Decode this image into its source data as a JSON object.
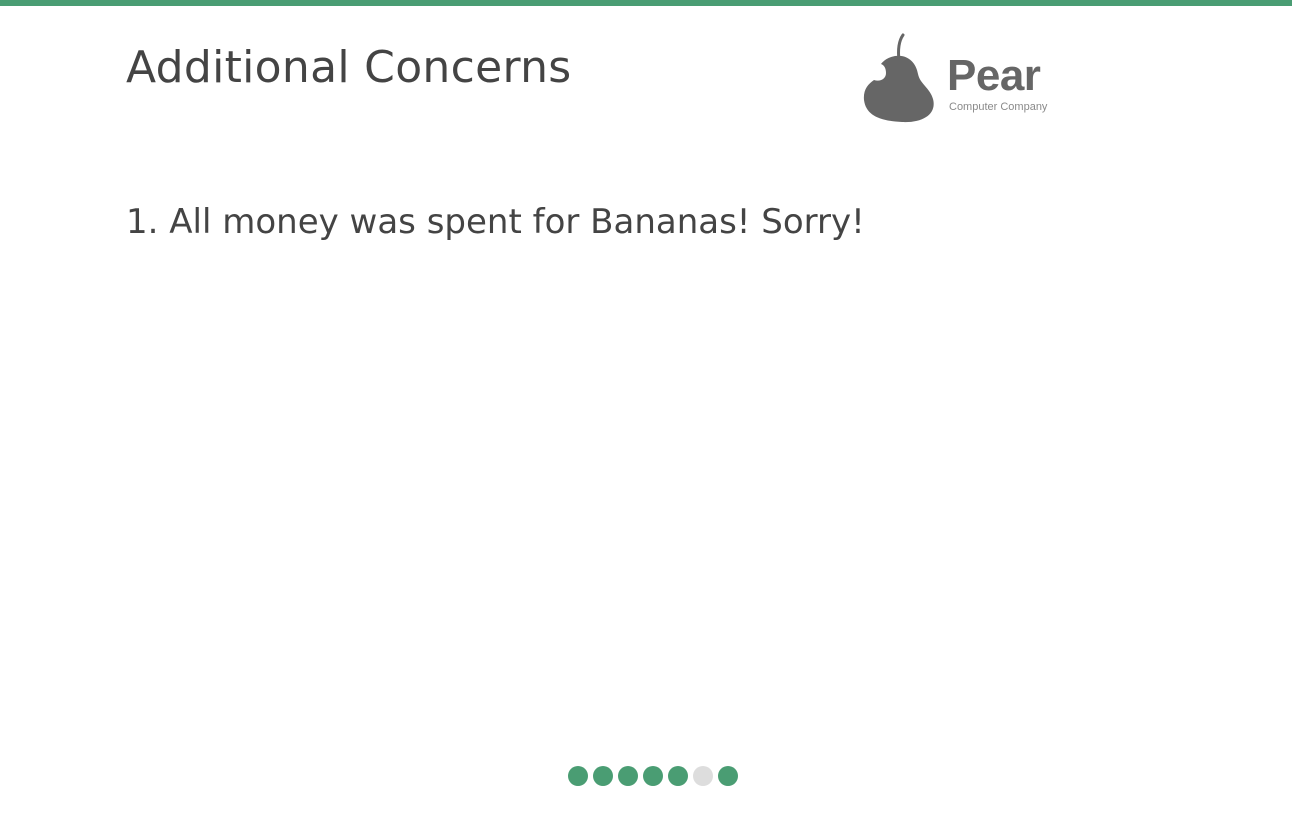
{
  "slide": {
    "title": "Additional Concerns",
    "items": [
      {
        "number": "1.",
        "text": "All money was spent for Bananas! Sorry!"
      }
    ]
  },
  "logo": {
    "name": "Pear",
    "tagline": "Computer Company",
    "icon": "pear-icon",
    "color": "#666666"
  },
  "progress": {
    "total": 7,
    "current_index": 5,
    "active_color": "#4a9d73",
    "inactive_color": "#dddddd"
  },
  "colors": {
    "accent": "#4a9d73",
    "text": "#444444"
  }
}
